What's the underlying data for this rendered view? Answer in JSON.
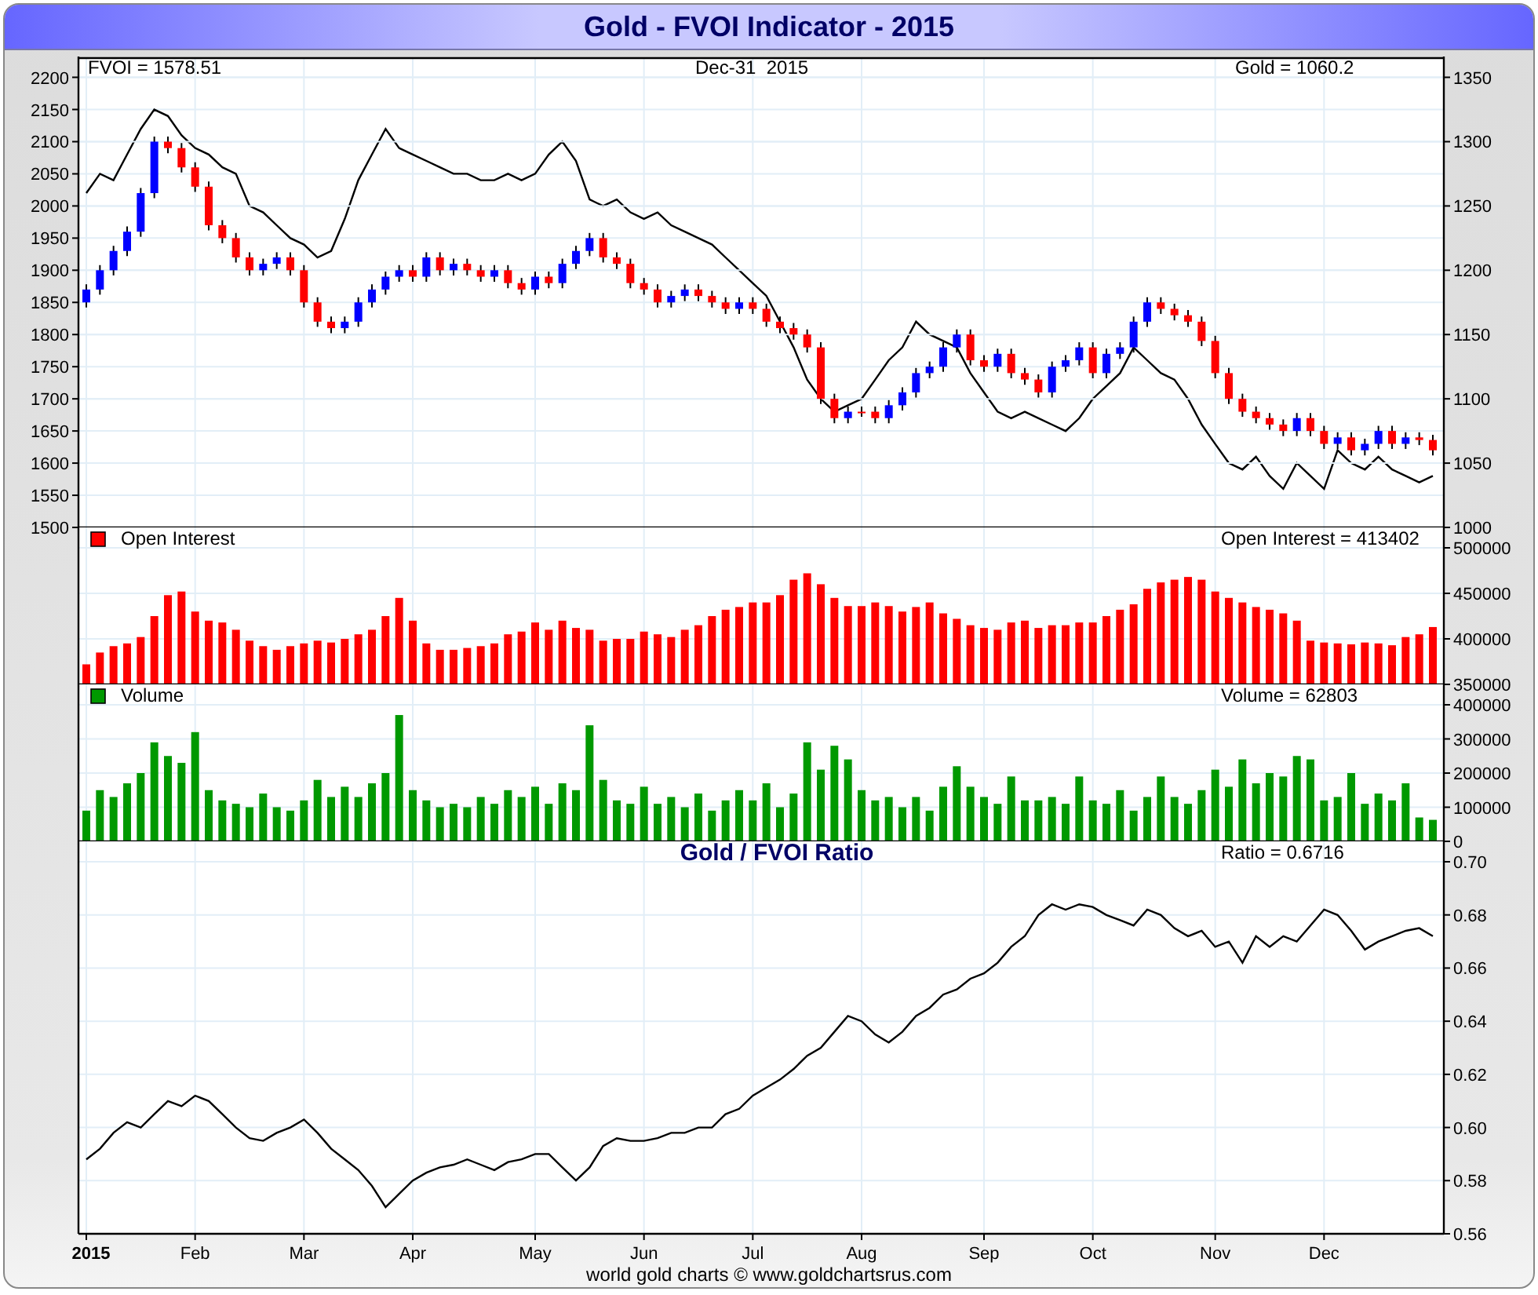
{
  "title": "Gold - FVOI Indicator - 2015",
  "panels": [
    {
      "kind": "price",
      "date_label": "Dec-31  2015",
      "charts": [
        {
          "reading": "FVOI = 1578.51",
          "chart_data": {
            "type": "line",
            "grid": true,
            "ylim": [
              1500,
              2230
            ],
            "yticks": [
              1500,
              1550,
              1600,
              1650,
              1700,
              1750,
              1800,
              1850,
              1900,
              1950,
              2000,
              2050,
              2100,
              2150,
              2200
            ],
            "categories": [
              null,
              null,
              null,
              null,
              null,
              null,
              null,
              null,
              null,
              null,
              null,
              null,
              null,
              null,
              null,
              null,
              null,
              null,
              null,
              null,
              null,
              null,
              null,
              null,
              null,
              null,
              null,
              null,
              null,
              null,
              null,
              null,
              null,
              null,
              null,
              null,
              null,
              null,
              null,
              null,
              null,
              null,
              null,
              null,
              null,
              null,
              null,
              null,
              null,
              null,
              null,
              null,
              null,
              null,
              null,
              null,
              null,
              null,
              null,
              null,
              null,
              null,
              null,
              null,
              null,
              null,
              null,
              null,
              null,
              null,
              null,
              null,
              null,
              null,
              null,
              null,
              null,
              null,
              null,
              null,
              null,
              null,
              null,
              null,
              null,
              null,
              null,
              null,
              null,
              null,
              null,
              null,
              null,
              null,
              null,
              null,
              null,
              null,
              null,
              null
            ],
            "series": [
              {
                "color": "#000000",
                "values": [
                  2020,
                  2050,
                  2040,
                  2080,
                  2120,
                  2150,
                  2140,
                  2110,
                  2090,
                  2080,
                  2060,
                  2050,
                  2000,
                  1990,
                  1970,
                  1950,
                  1940,
                  1920,
                  1930,
                  1980,
                  2040,
                  2080,
                  2120,
                  2090,
                  2080,
                  2070,
                  2060,
                  2050,
                  2050,
                  2040,
                  2040,
                  2050,
                  2040,
                  2050,
                  2080,
                  2100,
                  2070,
                  2010,
                  2000,
                  2010,
                  1990,
                  1980,
                  1990,
                  1970,
                  1960,
                  1950,
                  1940,
                  1920,
                  1900,
                  1880,
                  1860,
                  1820,
                  1780,
                  1730,
                  1700,
                  1680,
                  1690,
                  1700,
                  1730,
                  1760,
                  1780,
                  1820,
                  1800,
                  1790,
                  1780,
                  1740,
                  1710,
                  1680,
                  1670,
                  1680,
                  1670,
                  1660,
                  1650,
                  1670,
                  1700,
                  1720,
                  1740,
                  1780,
                  1760,
                  1740,
                  1730,
                  1700,
                  1660,
                  1630,
                  1600,
                  1590,
                  1610,
                  1580,
                  1560,
                  1600,
                  1580,
                  1560,
                  1620,
                  1600,
                  1590,
                  1610,
                  1590,
                  1580,
                  1570,
                  1580
                ]
              }
            ]
          }
        },
        {
          "reading": "Gold = 1060.2",
          "chart_data": {
            "type": "candlestick",
            "grid": true,
            "ylim": [
              1000,
              1365
            ],
            "yticks": [
              1000,
              1050,
              1100,
              1150,
              1200,
              1250,
              1300,
              1350
            ],
            "categories": [
              null,
              null,
              null,
              null,
              null,
              null,
              null,
              null,
              null,
              null,
              null,
              null,
              null,
              null,
              null,
              null,
              null,
              null,
              null,
              null,
              null,
              null,
              null,
              null,
              null,
              null,
              null,
              null,
              null,
              null,
              null,
              null,
              null,
              null,
              null,
              null,
              null,
              null,
              null,
              null,
              null,
              null,
              null,
              null,
              null,
              null,
              null,
              null,
              null,
              null,
              null,
              null,
              null,
              null,
              null,
              null,
              null,
              null,
              null,
              null,
              null,
              null,
              null,
              null,
              null,
              null,
              null,
              null,
              null,
              null,
              null,
              null,
              null,
              null,
              null,
              null,
              null,
              null,
              null,
              null,
              null,
              null,
              null,
              null,
              null,
              null,
              null,
              null,
              null,
              null,
              null,
              null,
              null,
              null,
              null,
              null,
              null,
              null,
              null,
              null
            ],
            "ohlc": [
              [
                1175,
                1189,
                1171,
                1185
              ],
              [
                1185,
                1204,
                1181,
                1200
              ],
              [
                1200,
                1219,
                1196,
                1215
              ],
              [
                1215,
                1234,
                1211,
                1230
              ],
              [
                1230,
                1264,
                1226,
                1260
              ],
              [
                1260,
                1304,
                1256,
                1300
              ],
              [
                1300,
                1304,
                1291,
                1295
              ],
              [
                1295,
                1299,
                1276,
                1280
              ],
              [
                1280,
                1284,
                1261,
                1265
              ],
              [
                1265,
                1269,
                1231,
                1235
              ],
              [
                1235,
                1239,
                1221,
                1225
              ],
              [
                1225,
                1229,
                1206,
                1210
              ],
              [
                1210,
                1214,
                1196,
                1200
              ],
              [
                1200,
                1209,
                1196,
                1205
              ],
              [
                1205,
                1214,
                1201,
                1210
              ],
              [
                1210,
                1214,
                1196,
                1200
              ],
              [
                1200,
                1204,
                1171,
                1175
              ],
              [
                1175,
                1179,
                1156,
                1160
              ],
              [
                1160,
                1164,
                1151,
                1155
              ],
              [
                1155,
                1164,
                1151,
                1160
              ],
              [
                1160,
                1179,
                1156,
                1175
              ],
              [
                1175,
                1189,
                1171,
                1185
              ],
              [
                1185,
                1199,
                1181,
                1195
              ],
              [
                1195,
                1204,
                1191,
                1200
              ],
              [
                1200,
                1204,
                1191,
                1195
              ],
              [
                1195,
                1214,
                1191,
                1210
              ],
              [
                1210,
                1214,
                1196,
                1200
              ],
              [
                1200,
                1209,
                1196,
                1205
              ],
              [
                1205,
                1209,
                1196,
                1200
              ],
              [
                1200,
                1204,
                1191,
                1195
              ],
              [
                1195,
                1204,
                1191,
                1200
              ],
              [
                1200,
                1204,
                1186,
                1190
              ],
              [
                1190,
                1194,
                1181,
                1185
              ],
              [
                1185,
                1199,
                1181,
                1195
              ],
              [
                1195,
                1199,
                1186,
                1190
              ],
              [
                1190,
                1209,
                1186,
                1205
              ],
              [
                1205,
                1219,
                1201,
                1215
              ],
              [
                1215,
                1229,
                1211,
                1225
              ],
              [
                1225,
                1229,
                1206,
                1210
              ],
              [
                1210,
                1214,
                1201,
                1205
              ],
              [
                1205,
                1209,
                1186,
                1190
              ],
              [
                1190,
                1194,
                1181,
                1185
              ],
              [
                1185,
                1189,
                1171,
                1175
              ],
              [
                1175,
                1184,
                1171,
                1180
              ],
              [
                1180,
                1189,
                1176,
                1185
              ],
              [
                1185,
                1189,
                1176,
                1180
              ],
              [
                1180,
                1184,
                1171,
                1175
              ],
              [
                1175,
                1179,
                1166,
                1170
              ],
              [
                1170,
                1179,
                1166,
                1175
              ],
              [
                1175,
                1179,
                1166,
                1170
              ],
              [
                1170,
                1174,
                1156,
                1160
              ],
              [
                1160,
                1164,
                1151,
                1155
              ],
              [
                1155,
                1159,
                1146,
                1150
              ],
              [
                1150,
                1154,
                1136,
                1140
              ],
              [
                1140,
                1144,
                1096,
                1100
              ],
              [
                1100,
                1104,
                1081,
                1085
              ],
              [
                1085,
                1094,
                1081,
                1090
              ],
              [
                1090,
                1094,
                1086,
                1090
              ],
              [
                1090,
                1094,
                1081,
                1085
              ],
              [
                1085,
                1099,
                1081,
                1095
              ],
              [
                1095,
                1109,
                1091,
                1105
              ],
              [
                1105,
                1124,
                1101,
                1120
              ],
              [
                1120,
                1129,
                1116,
                1125
              ],
              [
                1125,
                1144,
                1121,
                1140
              ],
              [
                1140,
                1154,
                1136,
                1150
              ],
              [
                1150,
                1154,
                1126,
                1130
              ],
              [
                1130,
                1134,
                1121,
                1125
              ],
              [
                1125,
                1139,
                1121,
                1135
              ],
              [
                1135,
                1139,
                1116,
                1120
              ],
              [
                1120,
                1124,
                1111,
                1115
              ],
              [
                1115,
                1119,
                1101,
                1105
              ],
              [
                1105,
                1129,
                1101,
                1125
              ],
              [
                1125,
                1134,
                1121,
                1130
              ],
              [
                1130,
                1144,
                1126,
                1140
              ],
              [
                1140,
                1144,
                1116,
                1120
              ],
              [
                1120,
                1139,
                1116,
                1135
              ],
              [
                1135,
                1144,
                1131,
                1140
              ],
              [
                1140,
                1164,
                1136,
                1160
              ],
              [
                1160,
                1179,
                1156,
                1175
              ],
              [
                1175,
                1179,
                1166,
                1170
              ],
              [
                1170,
                1174,
                1161,
                1165
              ],
              [
                1165,
                1169,
                1156,
                1160
              ],
              [
                1160,
                1164,
                1141,
                1145
              ],
              [
                1145,
                1149,
                1116,
                1120
              ],
              [
                1120,
                1124,
                1096,
                1100
              ],
              [
                1100,
                1104,
                1086,
                1090
              ],
              [
                1090,
                1094,
                1081,
                1085
              ],
              [
                1085,
                1089,
                1076,
                1080
              ],
              [
                1080,
                1084,
                1071,
                1075
              ],
              [
                1075,
                1089,
                1071,
                1085
              ],
              [
                1085,
                1089,
                1071,
                1075
              ],
              [
                1075,
                1079,
                1061,
                1065
              ],
              [
                1065,
                1074,
                1061,
                1070
              ],
              [
                1070,
                1074,
                1056,
                1060
              ],
              [
                1060,
                1069,
                1056,
                1065
              ],
              [
                1065,
                1079,
                1061,
                1075
              ],
              [
                1075,
                1079,
                1061,
                1065
              ],
              [
                1065,
                1074,
                1061,
                1070
              ],
              [
                1070,
                1074,
                1064,
                1068
              ],
              [
                1068,
                1072,
                1056,
                1060
              ]
            ]
          }
        }
      ]
    },
    {
      "kind": "bars",
      "charts": [
        {
          "legend": "Open Interest",
          "reading": "Open Interest = 413402",
          "chart_data": {
            "type": "bar",
            "grid": true,
            "ylim": [
              350000,
              500000
            ],
            "yticks": [
              350000,
              400000,
              450000,
              500000
            ],
            "categories": [
              null,
              null,
              null,
              null,
              null,
              null,
              null,
              null,
              null,
              null,
              null,
              null,
              null,
              null,
              null,
              null,
              null,
              null,
              null,
              null,
              null,
              null,
              null,
              null,
              null,
              null,
              null,
              null,
              null,
              null,
              null,
              null,
              null,
              null,
              null,
              null,
              null,
              null,
              null,
              null,
              null,
              null,
              null,
              null,
              null,
              null,
              null,
              null,
              null,
              null,
              null,
              null,
              null,
              null,
              null,
              null,
              null,
              null,
              null,
              null,
              null,
              null,
              null,
              null,
              null,
              null,
              null,
              null,
              null,
              null,
              null,
              null,
              null,
              null,
              null,
              null,
              null,
              null,
              null,
              null,
              null,
              null,
              null,
              null,
              null,
              null,
              null,
              null,
              null,
              null,
              null,
              null,
              null,
              null,
              null,
              null,
              null,
              null,
              null,
              null
            ],
            "series": [
              {
                "color": "#ff0000",
                "values": [
                  372000,
                  385000,
                  392000,
                  395000,
                  402000,
                  425000,
                  448000,
                  452000,
                  430000,
                  420000,
                  418000,
                  410000,
                  398000,
                  392000,
                  388000,
                  392000,
                  395000,
                  398000,
                  396000,
                  400000,
                  405000,
                  410000,
                  425000,
                  445000,
                  420000,
                  395000,
                  388000,
                  388000,
                  390000,
                  392000,
                  395000,
                  405000,
                  408000,
                  418000,
                  410000,
                  420000,
                  412000,
                  410000,
                  398000,
                  400000,
                  400000,
                  408000,
                  405000,
                  402000,
                  410000,
                  415000,
                  425000,
                  432000,
                  435000,
                  440000,
                  440000,
                  448000,
                  465000,
                  472000,
                  460000,
                  445000,
                  436000,
                  436000,
                  440000,
                  436000,
                  430000,
                  435000,
                  440000,
                  428000,
                  422000,
                  415000,
                  412000,
                  410000,
                  418000,
                  420000,
                  412000,
                  415000,
                  415000,
                  418000,
                  418000,
                  425000,
                  432000,
                  438000,
                  455000,
                  462000,
                  465000,
                  468000,
                  465000,
                  452000,
                  445000,
                  440000,
                  435000,
                  432000,
                  428000,
                  420000,
                  398000,
                  396000,
                  395000,
                  394000,
                  396000,
                  395000,
                  393000,
                  402000,
                  405000,
                  413000
                ]
              }
            ]
          }
        }
      ]
    },
    {
      "kind": "bars",
      "charts": [
        {
          "legend": "Volume",
          "reading": "Volume = 62803",
          "chart_data": {
            "type": "bar",
            "grid": true,
            "ylim": [
              0,
              400000
            ],
            "yticks": [
              0,
              100000,
              200000,
              300000,
              400000
            ],
            "categories": [
              null,
              null,
              null,
              null,
              null,
              null,
              null,
              null,
              null,
              null,
              null,
              null,
              null,
              null,
              null,
              null,
              null,
              null,
              null,
              null,
              null,
              null,
              null,
              null,
              null,
              null,
              null,
              null,
              null,
              null,
              null,
              null,
              null,
              null,
              null,
              null,
              null,
              null,
              null,
              null,
              null,
              null,
              null,
              null,
              null,
              null,
              null,
              null,
              null,
              null,
              null,
              null,
              null,
              null,
              null,
              null,
              null,
              null,
              null,
              null,
              null,
              null,
              null,
              null,
              null,
              null,
              null,
              null,
              null,
              null,
              null,
              null,
              null,
              null,
              null,
              null,
              null,
              null,
              null,
              null,
              null,
              null,
              null,
              null,
              null,
              null,
              null,
              null,
              null,
              null,
              null,
              null,
              null,
              null,
              null,
              null,
              null,
              null,
              null,
              null
            ],
            "series": [
              {
                "color": "#009900",
                "values": [
                  90000,
                  150000,
                  130000,
                  170000,
                  200000,
                  290000,
                  250000,
                  230000,
                  320000,
                  150000,
                  120000,
                  110000,
                  100000,
                  140000,
                  100000,
                  90000,
                  120000,
                  180000,
                  130000,
                  160000,
                  130000,
                  170000,
                  200000,
                  370000,
                  150000,
                  120000,
                  100000,
                  110000,
                  100000,
                  130000,
                  110000,
                  150000,
                  130000,
                  160000,
                  110000,
                  170000,
                  150000,
                  340000,
                  180000,
                  120000,
                  110000,
                  160000,
                  110000,
                  130000,
                  100000,
                  140000,
                  90000,
                  120000,
                  150000,
                  120000,
                  170000,
                  100000,
                  140000,
                  290000,
                  210000,
                  280000,
                  240000,
                  150000,
                  120000,
                  130000,
                  100000,
                  130000,
                  90000,
                  160000,
                  220000,
                  160000,
                  130000,
                  110000,
                  190000,
                  120000,
                  120000,
                  130000,
                  110000,
                  190000,
                  120000,
                  110000,
                  150000,
                  90000,
                  130000,
                  190000,
                  130000,
                  110000,
                  150000,
                  210000,
                  160000,
                  240000,
                  170000,
                  200000,
                  190000,
                  250000,
                  240000,
                  120000,
                  130000,
                  200000,
                  110000,
                  140000,
                  120000,
                  170000,
                  70000,
                  63000
                ]
              }
            ]
          }
        }
      ]
    },
    {
      "kind": "line",
      "charts": [
        {
          "reading": "Ratio = 0.6716",
          "chart_data": {
            "type": "line",
            "title": "Gold / FVOI Ratio",
            "grid": true,
            "ylim": [
              0.56,
              0.7
            ],
            "yticks": [
              {
                "value": 0.56,
                "label": "0.56"
              },
              {
                "value": 0.58,
                "label": "0.58"
              },
              {
                "value": 0.6,
                "label": "0.60"
              },
              {
                "value": 0.62,
                "label": "0.62"
              },
              {
                "value": 0.64,
                "label": "0.64"
              },
              {
                "value": 0.66,
                "label": "0.66"
              },
              {
                "value": 0.68,
                "label": "0.68"
              },
              {
                "value": 0.7,
                "label": "0.70"
              }
            ],
            "categories": [
              "2015",
              null,
              null,
              null,
              null,
              null,
              null,
              null,
              "Feb",
              null,
              null,
              null,
              null,
              null,
              null,
              null,
              "Mar",
              null,
              null,
              null,
              null,
              null,
              null,
              null,
              "Apr",
              null,
              null,
              null,
              null,
              null,
              null,
              null,
              null,
              "May",
              null,
              null,
              null,
              null,
              null,
              null,
              null,
              "Jun",
              null,
              null,
              null,
              null,
              null,
              null,
              null,
              "Jul",
              null,
              null,
              null,
              null,
              null,
              null,
              null,
              "Aug",
              null,
              null,
              null,
              null,
              null,
              null,
              null,
              null,
              "Sep",
              null,
              null,
              null,
              null,
              null,
              null,
              null,
              "Oct",
              null,
              null,
              null,
              null,
              null,
              null,
              null,
              null,
              "Nov",
              null,
              null,
              null,
              null,
              null,
              null,
              null,
              "Dec",
              null,
              null,
              null,
              null,
              null,
              null,
              null,
              null
            ],
            "series": [
              {
                "color": "#000000",
                "values": [
                  0.588,
                  0.592,
                  0.598,
                  0.602,
                  0.6,
                  0.605,
                  0.61,
                  0.608,
                  0.612,
                  0.61,
                  0.605,
                  0.6,
                  0.596,
                  0.595,
                  0.598,
                  0.6,
                  0.603,
                  0.598,
                  0.592,
                  0.588,
                  0.584,
                  0.578,
                  0.57,
                  0.575,
                  0.58,
                  0.583,
                  0.585,
                  0.586,
                  0.588,
                  0.586,
                  0.584,
                  0.587,
                  0.588,
                  0.59,
                  0.59,
                  0.585,
                  0.58,
                  0.585,
                  0.593,
                  0.596,
                  0.595,
                  0.595,
                  0.596,
                  0.598,
                  0.598,
                  0.6,
                  0.6,
                  0.605,
                  0.607,
                  0.612,
                  0.615,
                  0.618,
                  0.622,
                  0.627,
                  0.63,
                  0.636,
                  0.642,
                  0.64,
                  0.635,
                  0.632,
                  0.636,
                  0.642,
                  0.645,
                  0.65,
                  0.652,
                  0.656,
                  0.658,
                  0.662,
                  0.668,
                  0.672,
                  0.68,
                  0.684,
                  0.682,
                  0.684,
                  0.683,
                  0.68,
                  0.678,
                  0.676,
                  0.682,
                  0.68,
                  0.675,
                  0.672,
                  0.674,
                  0.668,
                  0.67,
                  0.662,
                  0.672,
                  0.668,
                  0.672,
                  0.67,
                  0.676,
                  0.682,
                  0.68,
                  0.674,
                  0.667,
                  0.67,
                  0.672,
                  0.674,
                  0.675,
                  0.672
                ]
              }
            ]
          }
        }
      ]
    }
  ],
  "footer": "world gold charts © www.goldchartsrus.com"
}
